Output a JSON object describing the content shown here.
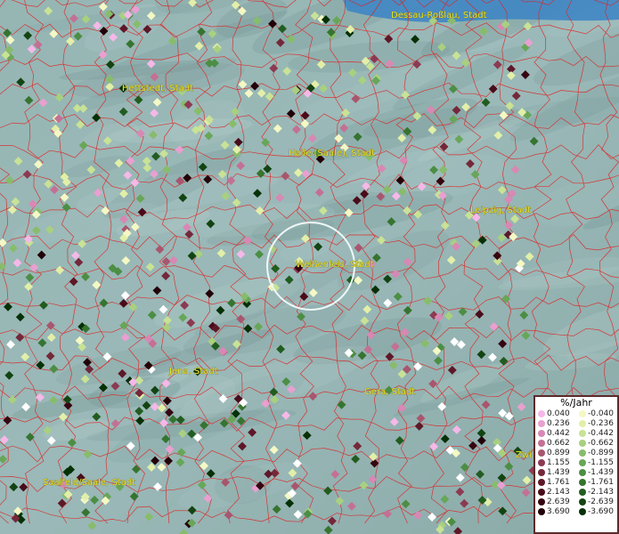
{
  "map": {
    "cities": [
      {
        "name": "Dessau-Roßlau, Stadt",
        "id": "dessau"
      },
      {
        "name": "Hettstedt, Stadt",
        "id": "hettstedt"
      },
      {
        "name": "Halle (Saale), Stadt",
        "id": "halle"
      },
      {
        "name": "Leipzig, Stadt",
        "id": "leipzig"
      },
      {
        "name": "Weißenfels, Stadt",
        "id": "weissenfels"
      },
      {
        "name": "Jena, Stadt",
        "id": "jena"
      },
      {
        "name": "Gera, Stadt",
        "id": "gera"
      },
      {
        "name": "Saalfeld/Saale, Stadt",
        "id": "saalfeld"
      },
      {
        "name": "Zwi",
        "id": "zwickau"
      }
    ],
    "colors": {
      "background": "#8fb0b0",
      "boundaries": "#e02020",
      "water": "#3a7fc0",
      "selection_circle": "#e8f4f4"
    }
  },
  "legend": {
    "title": "%/Jahr",
    "positive": [
      "0.040",
      "0.236",
      "0.442",
      "0.662",
      "0.899",
      "1.155",
      "1.439",
      "1.761",
      "2.143",
      "2.639",
      "3.690"
    ],
    "negative": [
      "-0.040",
      "-0.236",
      "-0.442",
      "-0.662",
      "-0.899",
      "-1.155",
      "-1.439",
      "-1.761",
      "-2.143",
      "-2.639",
      "-3.690"
    ],
    "positive_colors": [
      "#f5b8e8",
      "#e8a0d0",
      "#d888b4",
      "#c47094",
      "#a8566e",
      "#8c3a52",
      "#74283a",
      "#5e1828",
      "#4a0c1a",
      "#360610",
      "#220008"
    ],
    "negative_colors": [
      "#f4f8c4",
      "#e2efa8",
      "#c8e296",
      "#a8d080",
      "#88bc6c",
      "#68a658",
      "#4c8e44",
      "#367430",
      "#225c20",
      "#124412",
      "#063006"
    ]
  }
}
